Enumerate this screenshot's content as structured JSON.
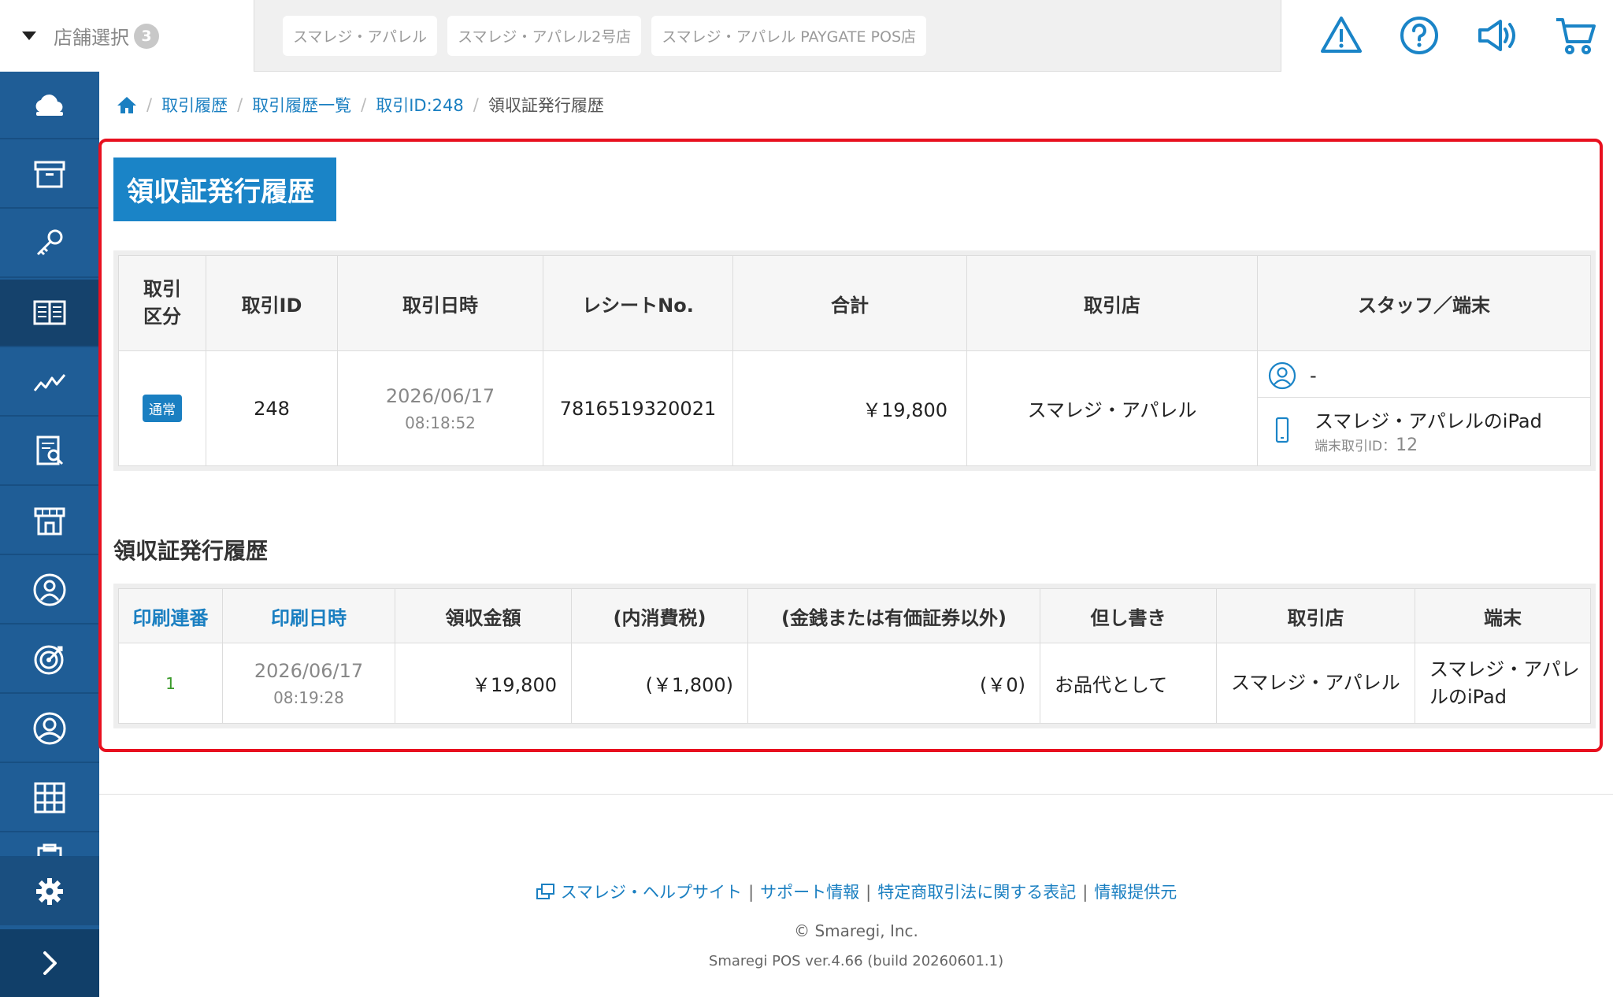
{
  "topbar": {
    "store_select_label": "店舗選択",
    "store_select_count": "3",
    "stores": [
      "スマレジ・アパレル",
      "スマレジ・アパレル2号店",
      "スマレジ・アパレル PAYGATE POS店"
    ],
    "icons": [
      "alert-icon",
      "help-icon",
      "announcement-icon",
      "cart-icon"
    ]
  },
  "sidebar": {
    "items": [
      "cloud-icon",
      "archive-icon",
      "key-icon",
      "book-icon",
      "analytics-icon",
      "report-icon",
      "store-icon",
      "customer-icon",
      "target-icon",
      "user-icon",
      "apps-icon",
      "clipboard-icon"
    ],
    "active_index": 3,
    "bottom": [
      "gear-icon",
      "chevron-right-icon"
    ]
  },
  "breadcrumb": {
    "home_icon": "home-icon",
    "items": [
      "取引履歴",
      "取引履歴一覧",
      "取引ID:248"
    ],
    "current": "領収証発行履歴"
  },
  "page_title": "領収証発行履歴",
  "transaction_table": {
    "headers": {
      "type": "取引\n区分",
      "id": "取引ID",
      "datetime": "取引日時",
      "receipt_no": "レシートNo.",
      "total": "合計",
      "store": "取引店",
      "staff_terminal": "スタッフ／端末"
    },
    "row": {
      "type_badge": "通常",
      "id": "248",
      "date": "2026/06/17",
      "time": "08:18:52",
      "receipt_no": "7816519320021",
      "total": "￥19,800",
      "store": "スマレジ・アパレル",
      "staff": "-",
      "terminal_name": "スマレジ・アパレルのiPad",
      "terminal_txn_label": "端末取引ID：",
      "terminal_txn_id": "12"
    }
  },
  "section_title": "領収証発行履歴",
  "receipt_table": {
    "headers": {
      "seq": "印刷連番",
      "printed_at": "印刷日時",
      "amount": "領収金額",
      "tax": "(内消費税)",
      "non_cash": "(金銭または有価証券以外)",
      "note": "但し書き",
      "store": "取引店",
      "terminal": "端末"
    },
    "row": {
      "seq": "1",
      "date": "2026/06/17",
      "time": "08:19:28",
      "amount": "￥19,800",
      "tax": "(￥1,800)",
      "non_cash": "(￥0)",
      "note": "お品代として",
      "store": "スマレジ・アパレル",
      "terminal": "スマレジ・アパレルのiPad"
    }
  },
  "footer": {
    "links": [
      "スマレジ・ヘルプサイト",
      "サポート情報",
      "特定商取引法に関する表記",
      "情報提供元"
    ],
    "separator": "|",
    "copyright": "© Smaregi, Inc.",
    "version": "Smaregi POS ver.4.66 (build 20260601.1)"
  },
  "colors": {
    "brand_blue": "#1a84c7",
    "sidebar_blue": "#1f5d96",
    "highlight_red": "#e8101f",
    "seq_green": "#3a9a2a"
  }
}
